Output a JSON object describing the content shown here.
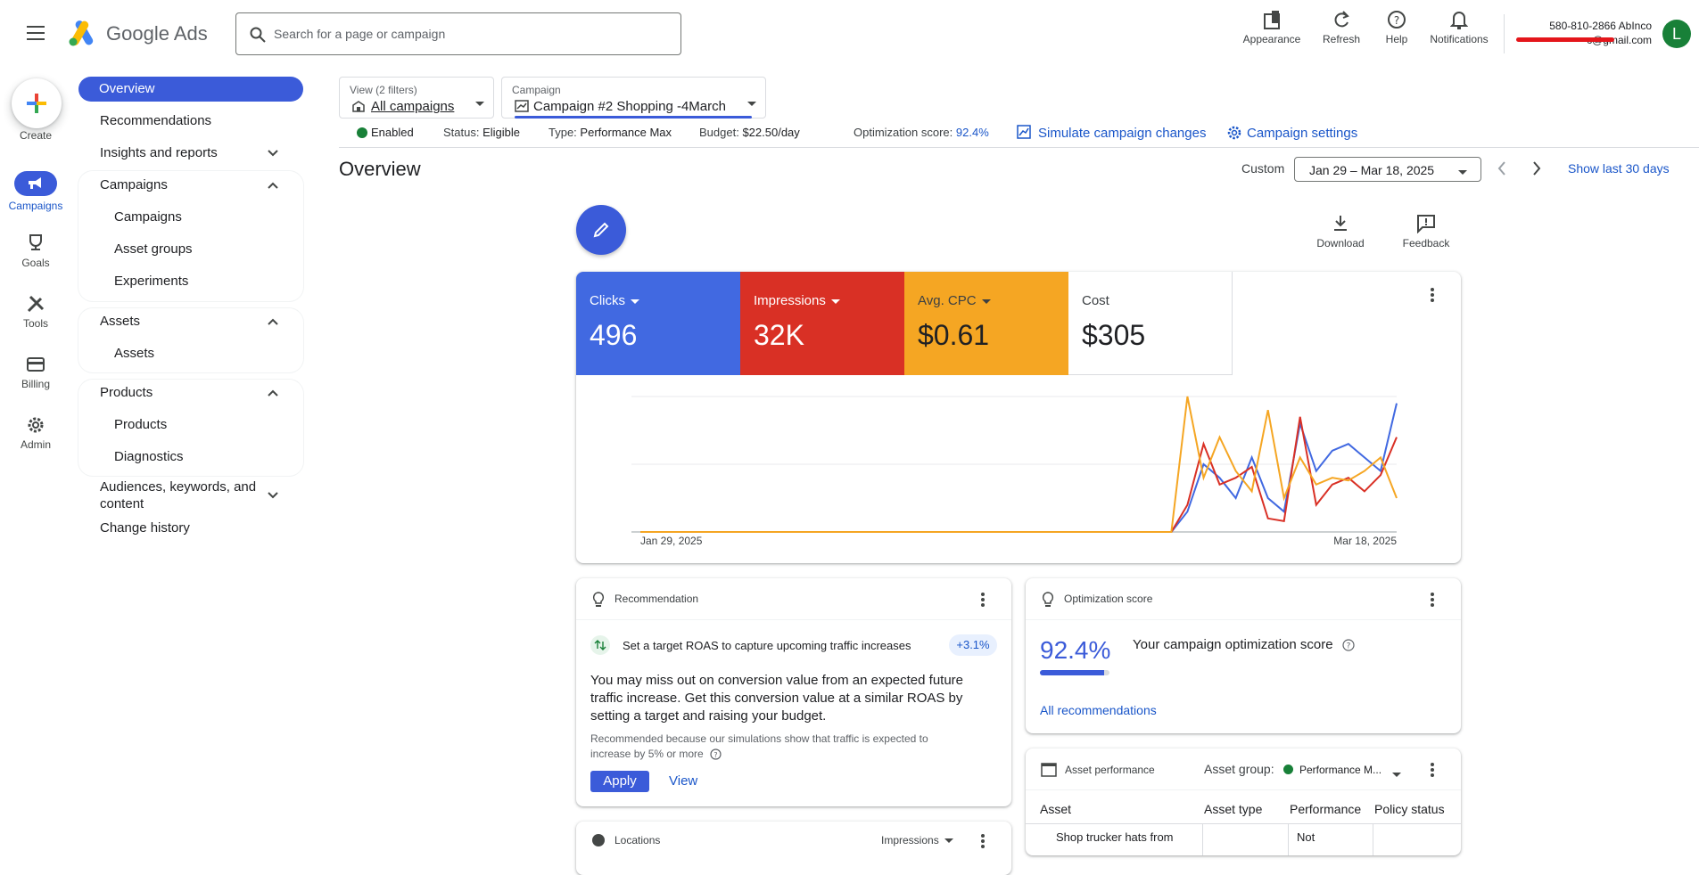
{
  "header": {
    "app_name": "Google Ads",
    "search_placeholder": "Search for a page or campaign",
    "actions": {
      "appearance": "Appearance",
      "refresh": "Refresh",
      "help": "Help",
      "notifications": "Notifications"
    },
    "account": {
      "phone_name": "580-810-2866 AbInco",
      "email_suffix": "c@gmail.com",
      "avatar_letter": "L"
    }
  },
  "rail": {
    "create": "Create",
    "campaigns": "Campaigns",
    "goals": "Goals",
    "tools": "Tools",
    "billing": "Billing",
    "admin": "Admin"
  },
  "sidebar": {
    "overview": "Overview",
    "recommendations": "Recommendations",
    "insights": "Insights and reports",
    "campaigns_group": "Campaigns",
    "campaigns": "Campaigns",
    "asset_groups": "Asset groups",
    "experiments": "Experiments",
    "assets_group": "Assets",
    "assets": "Assets",
    "products_group": "Products",
    "products": "Products",
    "diagnostics": "Diagnostics",
    "audiences_line1": "Audiences, keywords, and",
    "audiences_line2": "content",
    "change_history": "Change history"
  },
  "filters": {
    "view_label": "View (2 filters)",
    "view_value": "All campaigns",
    "campaign_label": "Campaign",
    "campaign_value": "Campaign #2 Shopping -4March"
  },
  "status_bar": {
    "enabled": "Enabled",
    "status_label": "Status:",
    "status_value": "Eligible",
    "type_label": "Type:",
    "type_value": "Performance Max",
    "budget_label": "Budget:",
    "budget_value": "$22.50/day",
    "opt_label": "Optimization score:",
    "opt_value": "92.4%",
    "simulate": "Simulate campaign changes",
    "settings": "Campaign settings"
  },
  "overview": {
    "title": "Overview",
    "date_mode": "Custom",
    "date_range": "Jan 29 – Mar 18, 2025",
    "show_last": "Show last 30 days",
    "download": "Download",
    "feedback": "Feedback"
  },
  "metrics": [
    {
      "label": "Clicks",
      "value": "496",
      "color": "#4169e1"
    },
    {
      "label": "Impressions",
      "value": "32K",
      "color": "#d93025"
    },
    {
      "label": "Avg. CPC",
      "value": "$0.61",
      "color": "#f5a623"
    },
    {
      "label": "Cost",
      "value": "$305",
      "color": "#ffffff"
    }
  ],
  "chart_data": {
    "type": "line",
    "x_start_label": "Jan 29, 2025",
    "x_end_label": "Mar 18, 2025",
    "grid": true,
    "series": [
      {
        "name": "Clicks",
        "color": "#4169e1",
        "values": [
          0,
          0,
          0,
          0,
          0,
          0,
          0,
          0,
          0,
          0,
          0,
          0,
          0,
          0,
          0,
          0,
          0,
          0,
          0,
          0,
          0,
          0,
          0,
          0,
          0,
          0,
          0,
          0,
          0,
          0,
          0,
          0,
          0,
          0,
          0.15,
          0.5,
          0.4,
          0.25,
          0.55,
          0.25,
          0.15,
          0.8,
          0.45,
          0.6,
          0.65,
          0.55,
          0.45,
          0.95
        ]
      },
      {
        "name": "Impressions",
        "color": "#d93025",
        "values": [
          0,
          0,
          0,
          0,
          0,
          0,
          0,
          0,
          0,
          0,
          0,
          0,
          0,
          0,
          0,
          0,
          0,
          0,
          0,
          0,
          0,
          0,
          0,
          0,
          0,
          0,
          0,
          0,
          0,
          0,
          0,
          0,
          0,
          0,
          0.2,
          0.65,
          0.35,
          0.4,
          0.48,
          0.1,
          0.08,
          0.85,
          0.2,
          0.35,
          0.4,
          0.3,
          0.42,
          0.7
        ]
      },
      {
        "name": "Avg. CPC",
        "color": "#f5a623",
        "values": [
          0,
          0,
          0,
          0,
          0,
          0,
          0,
          0,
          0,
          0,
          0,
          0,
          0,
          0,
          0,
          0,
          0,
          0,
          0,
          0,
          0,
          0,
          0,
          0,
          0,
          0,
          0,
          0,
          0,
          0,
          0,
          0,
          0,
          0,
          1.0,
          0.4,
          0.7,
          0.45,
          0.3,
          0.9,
          0.25,
          0.55,
          0.35,
          0.4,
          0.38,
          0.45,
          0.55,
          0.25
        ]
      }
    ]
  },
  "recommendation_card": {
    "title": "Recommendation",
    "headline": "Set a target ROAS to capture upcoming traffic increases",
    "badge": "+3.1%",
    "body_line1": "You may miss out on conversion value from an expected future",
    "body_line2": "traffic increase. Get this conversion value at a similar ROAS by",
    "body_line3": "setting a target and raising your budget.",
    "note_line1": "Recommended because our simulations show that traffic is expected to",
    "note_line2": "increase by 5% or more",
    "apply": "Apply",
    "view": "View"
  },
  "optimization_card": {
    "title": "Optimization score",
    "score": "92.4%",
    "score_fraction": 0.924,
    "label": "Your campaign optimization score",
    "all_recs": "All recommendations"
  },
  "asset_card": {
    "title": "Asset performance",
    "group_label": "Asset group:",
    "group_value": "Performance M...",
    "columns": [
      "Asset",
      "Asset type",
      "Performance",
      "Policy status"
    ],
    "row_asset": "Shop trucker hats from",
    "row_performance": "Not"
  },
  "locations_card": {
    "title": "Locations",
    "metric": "Impressions"
  }
}
